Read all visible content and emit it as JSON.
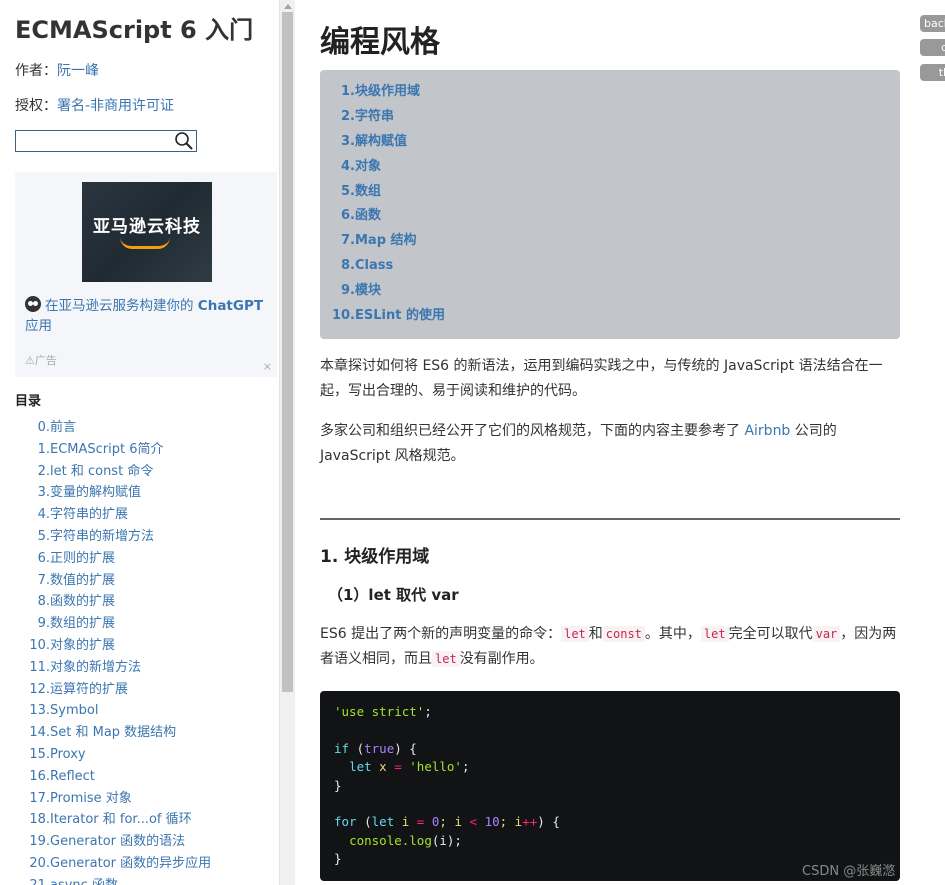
{
  "sidebar": {
    "book_title": "ECMAScript 6 入门",
    "author_label": "作者：",
    "author_name": "阮一峰",
    "license_label": "授权：",
    "license_name": "署名-非商用许可证",
    "search": {
      "value": "",
      "placeholder": ""
    },
    "ad": {
      "image_text": "亚马逊云科技",
      "link_text": "在亚马逊云服务构建你的 ",
      "link_bold": "ChatGPT",
      "link_suffix": "应用",
      "label": "广告",
      "close": "×"
    },
    "toc_heading": "目录",
    "toc": [
      {
        "num": "0.",
        "label": "前言"
      },
      {
        "num": "1.",
        "label": "ECMAScript 6简介"
      },
      {
        "num": "2.",
        "label": "let 和 const 命令"
      },
      {
        "num": "3.",
        "label": "变量的解构赋值"
      },
      {
        "num": "4.",
        "label": "字符串的扩展"
      },
      {
        "num": "5.",
        "label": "字符串的新增方法"
      },
      {
        "num": "6.",
        "label": "正则的扩展"
      },
      {
        "num": "7.",
        "label": "数值的扩展"
      },
      {
        "num": "8.",
        "label": "函数的扩展"
      },
      {
        "num": "9.",
        "label": "数组的扩展"
      },
      {
        "num": "10.",
        "label": "对象的扩展"
      },
      {
        "num": "11.",
        "label": "对象的新增方法"
      },
      {
        "num": "12.",
        "label": "运算符的扩展"
      },
      {
        "num": "13.",
        "label": "Symbol"
      },
      {
        "num": "14.",
        "label": "Set 和 Map 数据结构"
      },
      {
        "num": "15.",
        "label": "Proxy"
      },
      {
        "num": "16.",
        "label": "Reflect"
      },
      {
        "num": "17.",
        "label": "Promise 对象"
      },
      {
        "num": "18.",
        "label": "Iterator 和 for...of 循环"
      },
      {
        "num": "19.",
        "label": "Generator 函数的语法"
      },
      {
        "num": "20.",
        "label": "Generator 函数的异步应用"
      },
      {
        "num": "21.",
        "label": "async 函数"
      }
    ]
  },
  "main": {
    "title": "编程风格",
    "chapter_toc": [
      {
        "num": "1.",
        "label": "块级作用域"
      },
      {
        "num": "2.",
        "label": "字符串"
      },
      {
        "num": "3.",
        "label": "解构赋值"
      },
      {
        "num": "4.",
        "label": "对象"
      },
      {
        "num": "5.",
        "label": "数组"
      },
      {
        "num": "6.",
        "label": "函数"
      },
      {
        "num": "7.",
        "label": "Map 结构"
      },
      {
        "num": "8.",
        "label": "Class"
      },
      {
        "num": "9.",
        "label": "模块"
      },
      {
        "num": "10.",
        "label": "ESLint 的使用"
      }
    ],
    "para1": "本章探讨如何将 ES6 的新语法，运用到编码实践之中，与传统的 JavaScript 语法结合在一起，写出合理的、易于阅读和维护的代码。",
    "para2_prefix": "多家公司和组织已经公开了它们的风格规范，下面的内容主要参考了 ",
    "para2_link": "Airbnb",
    "para2_suffix": " 公司的 JavaScript 风格规范。",
    "h2": "1. 块级作用域",
    "h3": "（1）let 取代 var",
    "para3": {
      "t1": "ES6 提出了两个新的声明变量的命令：",
      "c1": "let",
      "t2": "和",
      "c2": "const",
      "t3": "。其中，",
      "c3": "let",
      "t4": "完全可以取代",
      "c4": "var",
      "t5": "，因为两者语义相同，而且",
      "c5": "let",
      "t6": "没有副作用。"
    },
    "code": {
      "l1_str": "'use strict'",
      "l1_end": ";",
      "l3_kw": "if",
      "l3_open": " (",
      "l3_bool": "true",
      "l3_close": ") {",
      "l4_indent": "  ",
      "l4_kw": "let",
      "l4_var": " x ",
      "l4_op": "=",
      "l4_sp": " ",
      "l4_str": "'hello'",
      "l4_end": ";",
      "l5": "}",
      "l7_kw": "for",
      "l7_a": " (",
      "l7_kw2": "let",
      "l7_b": " i ",
      "l7_op1": "=",
      "l7_c": " ",
      "l7_n1": "0",
      "l7_d": "; i ",
      "l7_op2": "<",
      "l7_e": " ",
      "l7_n2": "10",
      "l7_f": "; i",
      "l7_op3": "++",
      "l7_g": ") {",
      "l8_indent": "  ",
      "l8_fn": "console.log",
      "l8_rest": "(i);",
      "l9": "}"
    }
  },
  "watermark": "CSDN @张巍滺",
  "edge_badges": [
    "back",
    "c",
    "th"
  ]
}
